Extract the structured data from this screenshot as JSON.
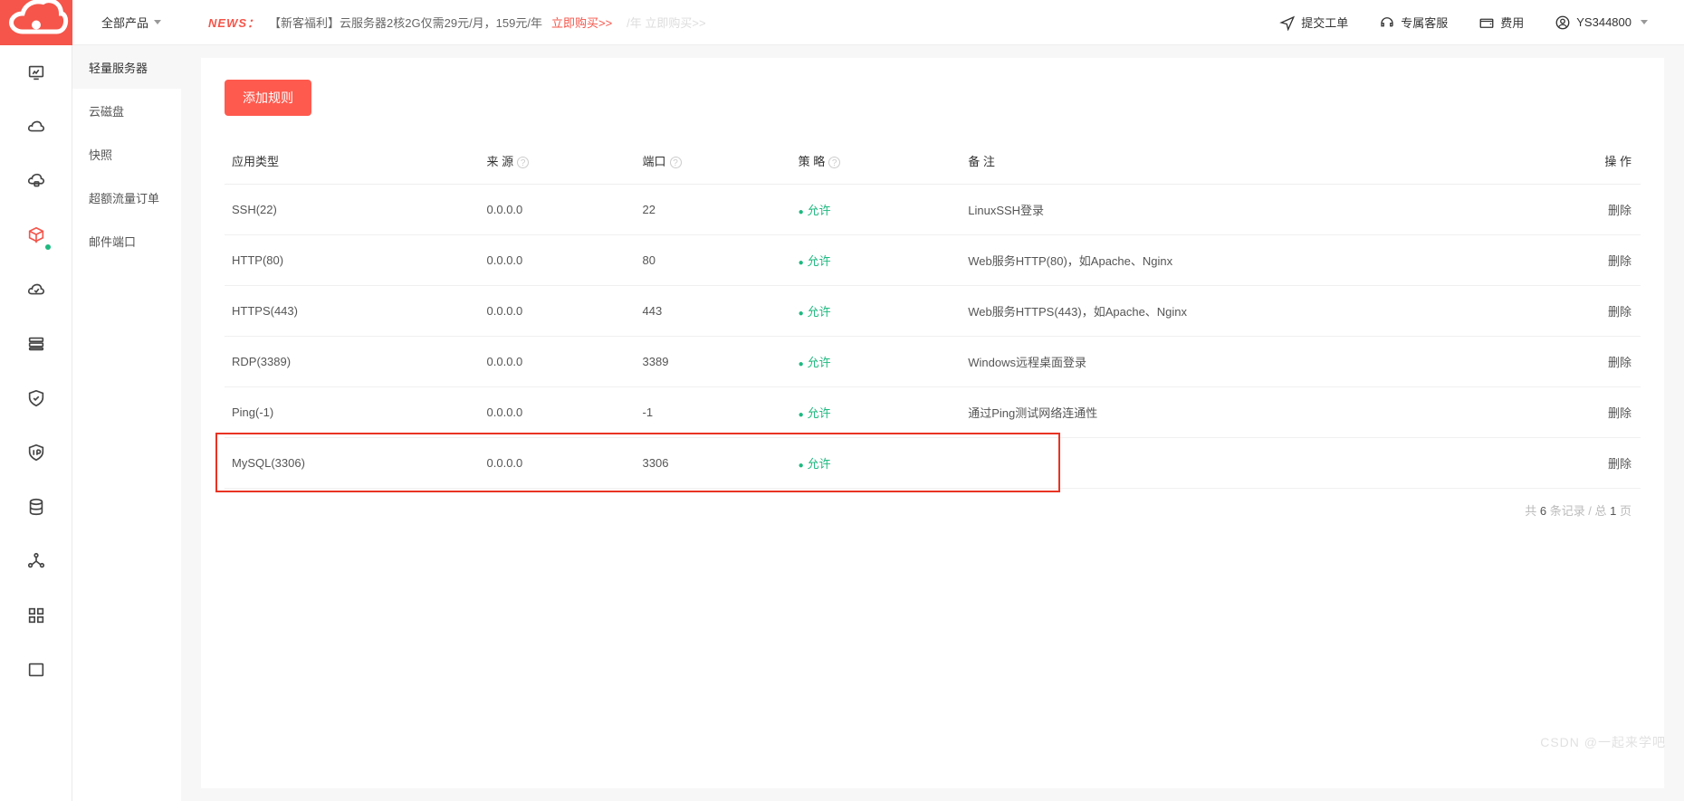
{
  "topbar": {
    "all_products": "全部产品",
    "news_label": "NEWS：",
    "news_text": "【新客福利】云服务器2核2G仅需29元/月，159元/年",
    "news_buy": "立即购买>>",
    "news_shadow": "/年 立即购买>>",
    "submit_ticket": "提交工单",
    "support": "专属客服",
    "billing": "费用",
    "user": "YS344800"
  },
  "sidebar": {
    "items": [
      {
        "label": "轻量服务器"
      },
      {
        "label": "云磁盘"
      },
      {
        "label": "快照"
      },
      {
        "label": "超额流量订单"
      },
      {
        "label": "邮件端口"
      }
    ]
  },
  "content": {
    "add_rule": "添加规则",
    "columns": {
      "app_type": "应用类型",
      "source": "来 源",
      "port": "端口",
      "policy": "策 略",
      "remark": "备 注",
      "op": "操 作"
    },
    "rows": [
      {
        "type": "SSH(22)",
        "source": "0.0.0.0",
        "port": "22",
        "policy": "允许",
        "remark": "LinuxSSH登录",
        "op": "删除"
      },
      {
        "type": "HTTP(80)",
        "source": "0.0.0.0",
        "port": "80",
        "policy": "允许",
        "remark": "Web服务HTTP(80)，如Apache、Nginx",
        "op": "删除"
      },
      {
        "type": "HTTPS(443)",
        "source": "0.0.0.0",
        "port": "443",
        "policy": "允许",
        "remark": "Web服务HTTPS(443)，如Apache、Nginx",
        "op": "删除"
      },
      {
        "type": "RDP(3389)",
        "source": "0.0.0.0",
        "port": "3389",
        "policy": "允许",
        "remark": "Windows远程桌面登录",
        "op": "删除"
      },
      {
        "type": "Ping(-1)",
        "source": "0.0.0.0",
        "port": "-1",
        "policy": "允许",
        "remark": "通过Ping测试网络连通性",
        "op": "删除"
      },
      {
        "type": "MySQL(3306)",
        "source": "0.0.0.0",
        "port": "3306",
        "policy": "允许",
        "remark": "",
        "op": "删除",
        "highlight": true
      }
    ],
    "pagination_prefix": "共 ",
    "pagination_count": "6",
    "pagination_mid": " 条记录 / 总 ",
    "pagination_pages": "1",
    "pagination_suffix": " 页"
  },
  "watermark": "CSDN @一起来学吧"
}
